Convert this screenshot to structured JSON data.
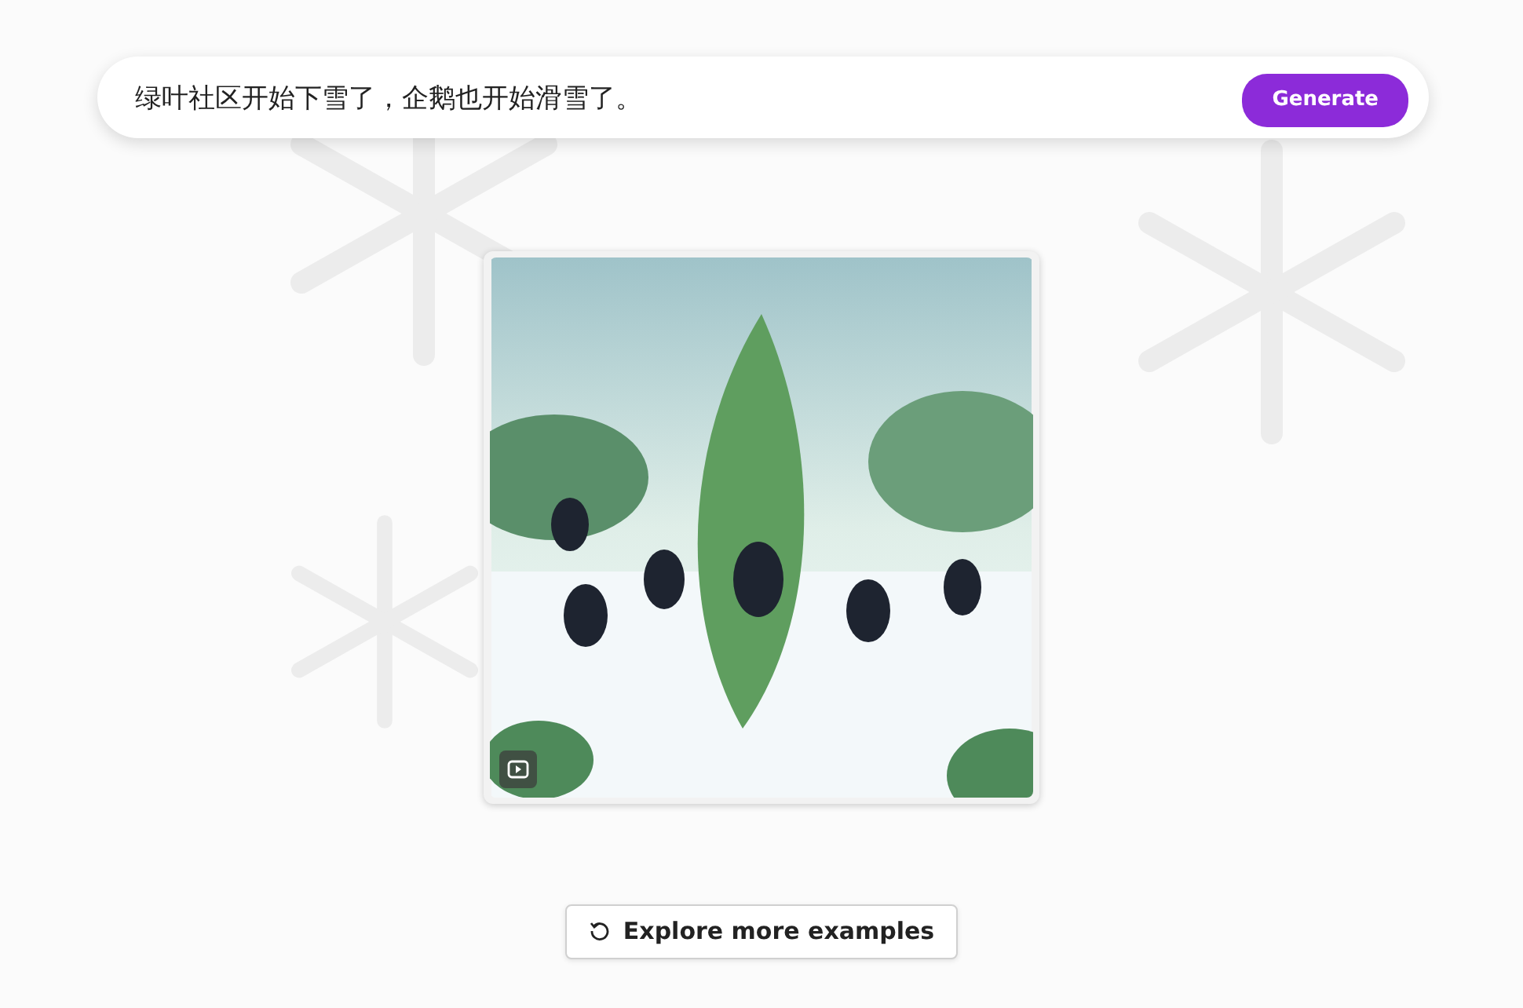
{
  "prompt": {
    "value": "绿叶社区开始下雪了，企鹅也开始滑雪了。"
  },
  "generate_button": {
    "label": "Generate"
  },
  "result": {
    "has_video": true
  },
  "explore_button": {
    "label": "Explore more examples"
  }
}
